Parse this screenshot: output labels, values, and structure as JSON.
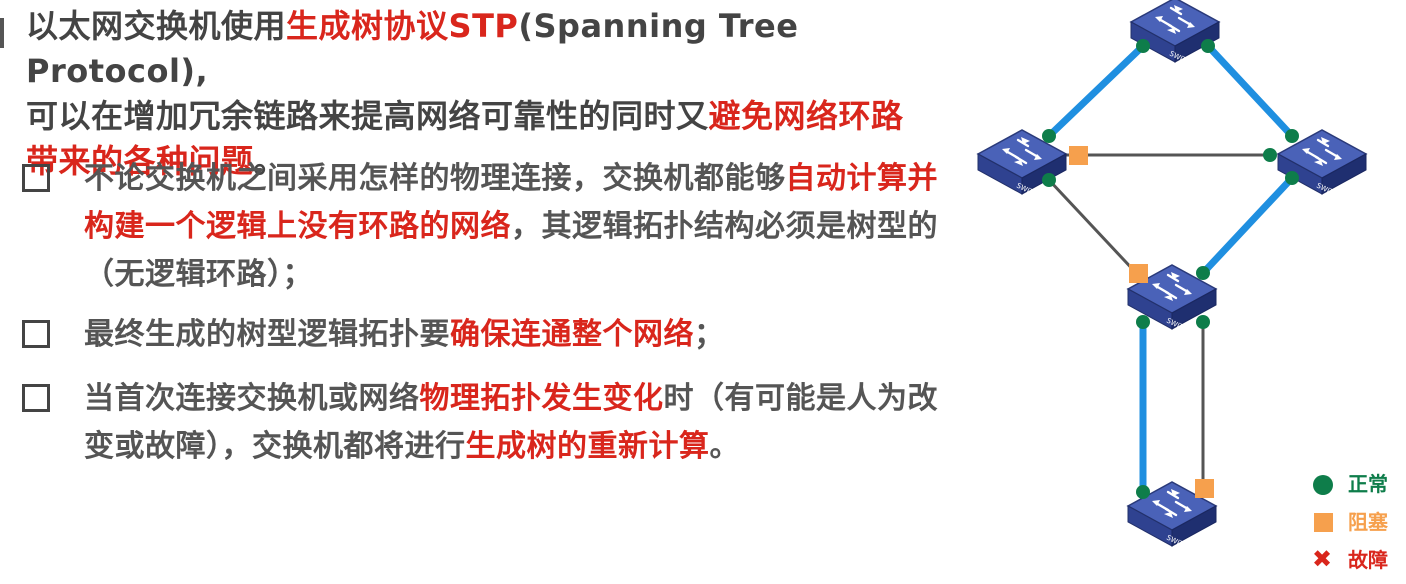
{
  "intro": {
    "p1": "以太网交换机使用",
    "p1_hl": "生成树协议STP",
    "p1_rest": "(Spanning Tree Protocol),",
    "p2": "可以在增加冗余链路来提高网络可靠性的同时又",
    "p2_hl": "避免网络环路",
    "p3_hl": "带来的各种问题",
    "p3_end": "。"
  },
  "bullets": [
    {
      "a": "不论交换机之间采用怎样的物理连接，交换机都能够",
      "hl": "自动计算并构建一个逻辑上没有环路的网络",
      "b": "，其逻辑拓扑结构必须是树型的（无逻辑环路）；"
    },
    {
      "a": "最终生成的树型逻辑拓扑要",
      "hl": "确保连通整个网络",
      "b": "；"
    },
    {
      "a": "当首次连接交换机或网络",
      "hl": "物理拓扑发生变化",
      "b": "时（有可能是人为改变或故障），交换机都将进行",
      "hl2": "生成树的重新计算",
      "c": "。"
    }
  ],
  "switch_label": "SWITCH",
  "legend": {
    "normal": "正常",
    "blocked": "阻塞",
    "fault": "故障"
  },
  "colors": {
    "highlight": "#d9261c",
    "body_text": "#444444",
    "active_link": "#1f8fe0",
    "inactive_link": "#555555",
    "normal_port": "#0e7d4a",
    "blocked_port": "#f6a04d",
    "switch_body": "#3a4d9c"
  }
}
